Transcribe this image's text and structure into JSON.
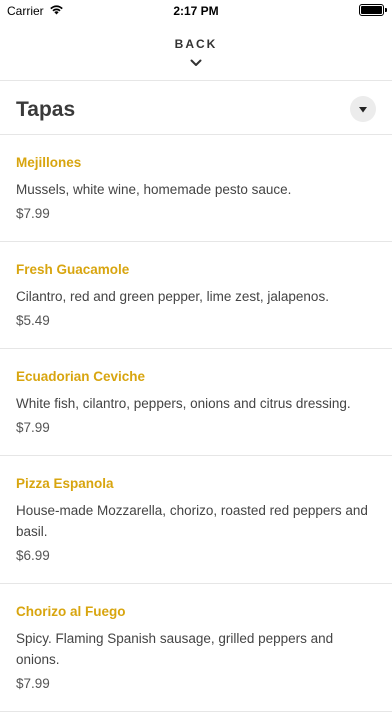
{
  "status_bar": {
    "carrier": "Carrier",
    "time": "2:17 PM",
    "icons": [
      "wifi-icon",
      "battery-icon"
    ]
  },
  "nav": {
    "back_label": "BACK",
    "back_icon": "chevron-down-icon"
  },
  "section": {
    "title": "Tapas",
    "toggle_icon": "triangle-down-icon"
  },
  "menu_items": [
    {
      "name": "Mejillones",
      "description": "Mussels, white wine, homemade pesto sauce.",
      "price": "$7.99"
    },
    {
      "name": "Fresh Guacamole",
      "description": "Cilantro, red and green pepper, lime zest, jalapenos.",
      "price": "$5.49"
    },
    {
      "name": "Ecuadorian Ceviche",
      "description": "White fish, cilantro, peppers, onions and citrus dressing.",
      "price": "$7.99"
    },
    {
      "name": "Pizza Espanola",
      "description": "House-made Mozzarella, chorizo, roasted red peppers and basil.",
      "price": "$6.99"
    },
    {
      "name": "Chorizo al Fuego",
      "description": "Spicy. Flaming Spanish sausage, grilled peppers and onions.",
      "price": "$7.99"
    }
  ],
  "colors": {
    "item_name": "#d8a50f",
    "divider": "#e6e6e6",
    "toggle_bg": "#ececec"
  }
}
